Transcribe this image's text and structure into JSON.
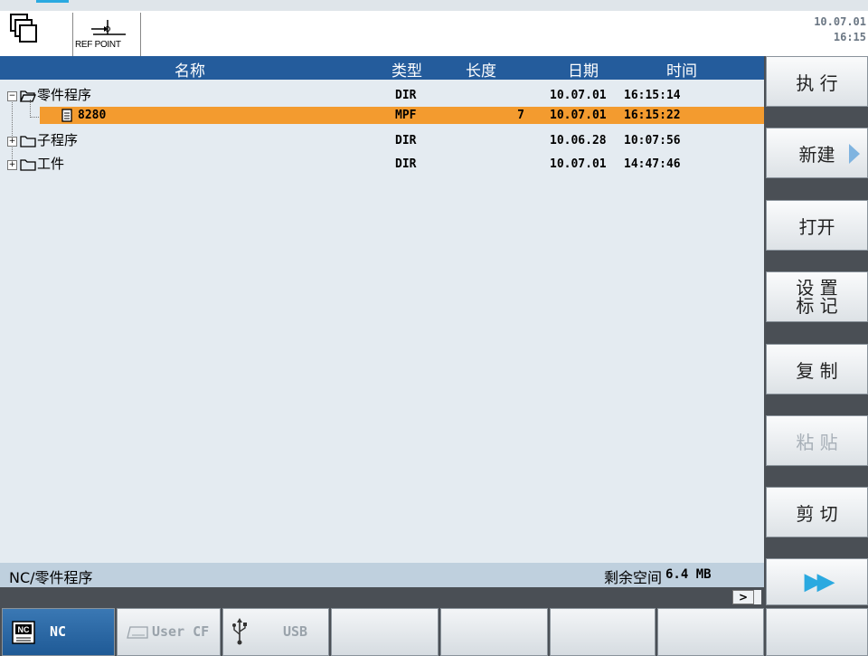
{
  "header": {
    "refpoint_label": "REF POINT",
    "date": "10.07.01",
    "time": "16:15"
  },
  "columns": {
    "name": "名称",
    "type": "类型",
    "length": "长度",
    "date": "日期",
    "time": "时间"
  },
  "rows": [
    {
      "name": "零件程序",
      "type": "DIR",
      "length": "",
      "date": "10.07.01",
      "time": "16:15:14",
      "icon": "folder-open-icon",
      "expanded": true,
      "selected": false
    },
    {
      "name": "8280",
      "type": "MPF",
      "length": "7",
      "date": "10.07.01",
      "time": "16:15:22",
      "icon": "file-icon",
      "selected": true
    },
    {
      "name": "子程序",
      "type": "DIR",
      "length": "",
      "date": "10.06.28",
      "time": "10:07:56",
      "icon": "folder-icon",
      "expanded": false,
      "selected": false
    },
    {
      "name": "工件",
      "type": "DIR",
      "length": "",
      "date": "10.07.01",
      "time": "14:47:46",
      "icon": "folder-icon",
      "expanded": false,
      "selected": false
    }
  ],
  "path": "NC/零件程序",
  "free_space_label": "剩余空间",
  "free_space_value": "6.4 MB",
  "scroll_button": ">",
  "softkeys": {
    "execute": "执 行",
    "new": "新建",
    "open": "打开",
    "set_mark_1": "设 置",
    "set_mark_2": "标 记",
    "copy": "复 制",
    "paste": "粘 贴",
    "cut": "剪 切",
    "more": "▶▶"
  },
  "tabs": {
    "nc": "NC",
    "user_cf": "User CF",
    "usb": "USB"
  },
  "colors": {
    "header_blue": "#245c9c",
    "selection_orange": "#f39b2f",
    "list_bg": "#e4ebf1",
    "more_arrow": "#2aa9e0"
  }
}
